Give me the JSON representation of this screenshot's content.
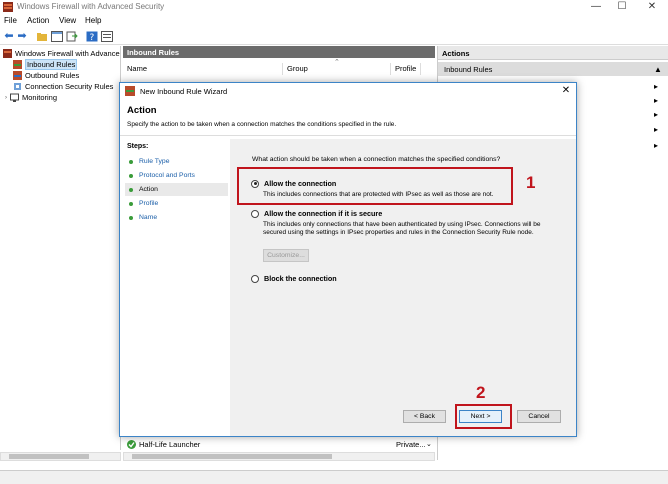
{
  "window": {
    "title": "Windows Firewall with Advanced Security",
    "controls": {
      "minimize": "—",
      "maximize": "☐",
      "close": "✕"
    }
  },
  "menu": {
    "file": "File",
    "action": "Action",
    "view": "View",
    "help": "Help"
  },
  "tree": {
    "root": "Windows Firewall with Advance",
    "items": [
      {
        "label": "Inbound Rules"
      },
      {
        "label": "Outbound Rules"
      },
      {
        "label": "Connection Security Rules"
      },
      {
        "label": "Monitoring"
      }
    ]
  },
  "center": {
    "header": "Inbound Rules",
    "columns": {
      "name": "Name",
      "group": "Group",
      "profile": "Profile"
    },
    "bottom_row": {
      "name": "Half-Life Launcher",
      "profile": "Private..."
    }
  },
  "actions": {
    "header": "Actions",
    "section": "Inbound Rules"
  },
  "dialog": {
    "title": "New Inbound Rule Wizard",
    "heading": "Action",
    "description": "Specify the action to be taken when a connection matches the conditions specified in the rule.",
    "steps_title": "Steps:",
    "steps": [
      {
        "label": "Rule Type"
      },
      {
        "label": "Protocol and Ports"
      },
      {
        "label": "Action"
      },
      {
        "label": "Profile"
      },
      {
        "label": "Name"
      }
    ],
    "question": "What action should be taken when a connection matches the specified conditions?",
    "options": [
      {
        "label": "Allow the connection",
        "desc": "This includes connections that are protected with IPsec as well as those are not.",
        "checked": true
      },
      {
        "label": "Allow the connection if it is secure",
        "desc": "This includes only connections that have been authenticated by using IPsec.  Connections will be secured using the settings in IPsec properties and rules in the Connection Security Rule node.",
        "checked": false
      },
      {
        "label": "Block the connection",
        "desc": "",
        "checked": false
      }
    ],
    "customize": "Customize...",
    "back": "< Back",
    "next": "Next >",
    "cancel": "Cancel"
  },
  "annotations": {
    "one": "1",
    "two": "2",
    "color": "#c0141c"
  }
}
